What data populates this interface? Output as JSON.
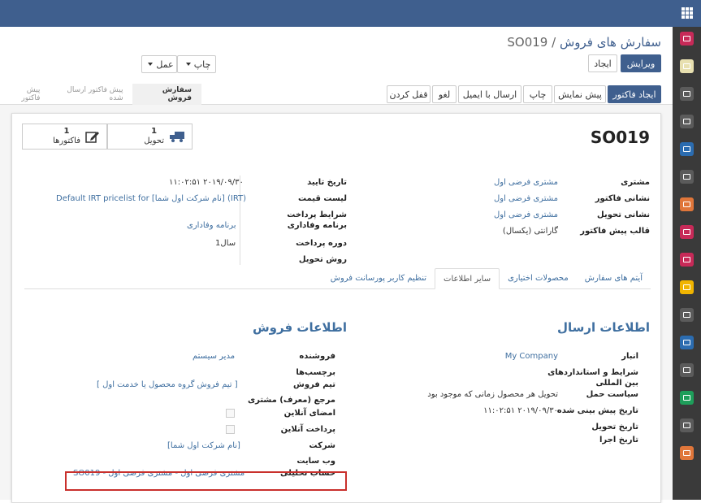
{
  "breadcrumb": {
    "parent": "سفارش های فروش",
    "separator": "/",
    "current": "SO019"
  },
  "buttons": {
    "edit": "ویرایش",
    "create": "ایجاد",
    "print": "چاپ",
    "action": "عمل"
  },
  "actions": {
    "create_invoice": "ایجاد فاکتور",
    "preview": "پیش نمایش",
    "print": "چاپ",
    "send_email": "ارسال با ایمیل",
    "cancel": "لغو",
    "lock": "قفل کردن"
  },
  "stages": [
    "سفارش فروش",
    "پیش فاکتور ارسال شده",
    "پیش فاکتور"
  ],
  "smart_buttons": {
    "delivery": {
      "count": "1",
      "label": "تحویل"
    },
    "invoices": {
      "count": "1",
      "label": "فاکتورها"
    }
  },
  "order_name": "SO019",
  "fields_left": [
    {
      "label": "مشتری",
      "value": "مشتری فرضی اول"
    },
    {
      "label": "نشانی فاکتور",
      "value": "مشتری فرضی اول"
    },
    {
      "label": "نشانی تحویل",
      "value": "مشتری فرضی اول"
    },
    {
      "label": "قالب پیش فاکتور",
      "value": "گارانتی (یکسال)"
    }
  ],
  "fields_right": [
    {
      "label": "تاریخ تایید",
      "value": "۱۱:۰۲:۵۱ ۲۰۱۹/۰۹/۳۰"
    },
    {
      "label": "لیست قیمت",
      "value": "Default IRT pricelist for [نام شرکت اول شما] (IRT)"
    },
    {
      "label": "شرایط پرداخت",
      "value": ""
    },
    {
      "label": "برنامه وفاداری",
      "value": "برنامه وفاداری"
    },
    {
      "label": "دوره پرداخت",
      "value": "1سال"
    },
    {
      "label": "روش تحویل",
      "value": ""
    }
  ],
  "tabs": [
    "آیتم های سفارش",
    "محصولات اختیاری",
    "سایر اطلاعات",
    "تنظیم کاربر پورسانت فروش"
  ],
  "shipping": {
    "title": "اطلاعات ارسال",
    "fields": [
      {
        "label": "انبار",
        "value": "My Company"
      },
      {
        "label": "شرایط و استانداردهای",
        "value": ""
      },
      {
        "label": "بین المللی",
        "value": ""
      },
      {
        "label": "سیاست حمل",
        "value": "تحویل هر محصول زمانی که موجود بود"
      },
      {
        "label": "تاریخ پیش بینی شده",
        "value": "۱۱:۰۲:۵۱ ۲۰۱۹/۰۹/۳۰"
      },
      {
        "label": "تاریخ تحویل",
        "value": ""
      },
      {
        "label": "تاریخ اجرا",
        "value": ""
      }
    ]
  },
  "sales": {
    "title": "اطلاعات فروش",
    "fields": [
      {
        "label": "فروشنده",
        "value": "مدیر سیستم"
      },
      {
        "label": "برچسب‌ها",
        "value": ""
      },
      {
        "label": "تیم فروش",
        "value": "[ تیم فروش گروه محصول یا خدمت اول ]"
      },
      {
        "label": "مرجع (معرف) مشتری",
        "value": ""
      },
      {
        "label": "امضای آنلاین",
        "value": ""
      },
      {
        "label": "پرداخت آنلاین",
        "value": ""
      },
      {
        "label": "شرکت",
        "value": "[نام شرکت اول شما]"
      },
      {
        "label": "وب سایت",
        "value": ""
      },
      {
        "label": "حساب تحلیلی",
        "value": "SO019 - مشتری فرضی اول - مشتری فرضی اول"
      }
    ]
  },
  "colors": {
    "brand": "#3f5f8e",
    "link": "#3f6fa0",
    "highlight": "#c9302c"
  },
  "sidebar_icons": [
    {
      "name": "discuss-icon",
      "color": "#c72a58"
    },
    {
      "name": "calendar-icon",
      "color": "#e8e0b0"
    },
    {
      "name": "contacts-icon",
      "color": "#5b5b5b"
    },
    {
      "name": "crm-icon",
      "color": "#5b5b5b"
    },
    {
      "name": "settings-icon",
      "color": "#2b6cb0"
    },
    {
      "name": "eye-icon",
      "color": "#5b5b5b"
    },
    {
      "name": "chart-icon",
      "color": "#e0763a"
    },
    {
      "name": "sales-icon",
      "color": "#c72a58"
    },
    {
      "name": "folder-icon",
      "color": "#c72a58"
    },
    {
      "name": "headset-icon",
      "color": "#f0b400"
    },
    {
      "name": "shop-icon",
      "color": "#5b5b5b"
    },
    {
      "name": "invoice-icon",
      "color": "#2b6cb0"
    },
    {
      "name": "inventory-icon",
      "color": "#5b5b5b"
    },
    {
      "name": "tools-icon",
      "color": "#1e9e5a"
    },
    {
      "name": "doc-icon",
      "color": "#5b5b5b"
    },
    {
      "name": "clock-icon",
      "color": "#e0763a"
    }
  ]
}
